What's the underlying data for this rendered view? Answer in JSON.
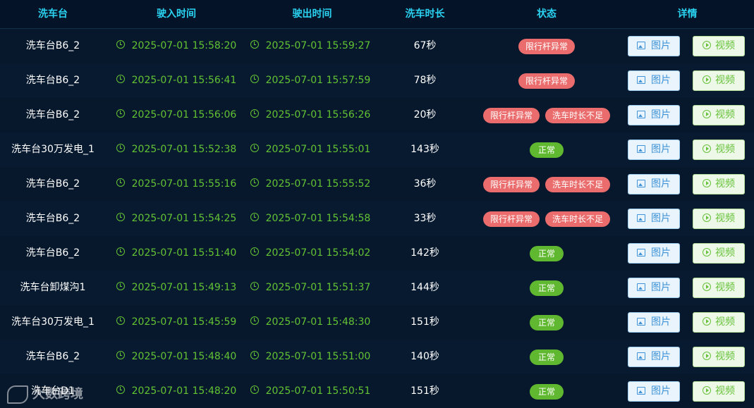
{
  "header": {
    "station": "洗车台",
    "entry_time": "驶入时间",
    "exit_time": "驶出时间",
    "duration": "洗车时长",
    "status": "状态",
    "detail": "详情"
  },
  "buttons": {
    "image_label": "图片",
    "video_label": "视频"
  },
  "colors": {
    "header_text": "#2ad3f2",
    "time_text": "#62c333",
    "error_badge": "#ea6c6c",
    "ok_badge": "#5fb82f"
  },
  "rows": [
    {
      "station": "洗车台B6_2",
      "entry": "2025-07-01 15:58:20",
      "exit": "2025-07-01 15:59:27",
      "duration": "67秒",
      "statuses": [
        {
          "label": "限行杆异常",
          "type": "error"
        }
      ]
    },
    {
      "station": "洗车台B6_2",
      "entry": "2025-07-01 15:56:41",
      "exit": "2025-07-01 15:57:59",
      "duration": "78秒",
      "statuses": [
        {
          "label": "限行杆异常",
          "type": "error"
        }
      ]
    },
    {
      "station": "洗车台B6_2",
      "entry": "2025-07-01 15:56:06",
      "exit": "2025-07-01 15:56:26",
      "duration": "20秒",
      "statuses": [
        {
          "label": "限行杆异常",
          "type": "error"
        },
        {
          "label": "洗车时长不足",
          "type": "error"
        }
      ]
    },
    {
      "station": "洗车台30万发电_1",
      "entry": "2025-07-01 15:52:38",
      "exit": "2025-07-01 15:55:01",
      "duration": "143秒",
      "statuses": [
        {
          "label": "正常",
          "type": "ok"
        }
      ]
    },
    {
      "station": "洗车台B6_2",
      "entry": "2025-07-01 15:55:16",
      "exit": "2025-07-01 15:55:52",
      "duration": "36秒",
      "statuses": [
        {
          "label": "限行杆异常",
          "type": "error"
        },
        {
          "label": "洗车时长不足",
          "type": "error"
        }
      ]
    },
    {
      "station": "洗车台B6_2",
      "entry": "2025-07-01 15:54:25",
      "exit": "2025-07-01 15:54:58",
      "duration": "33秒",
      "statuses": [
        {
          "label": "限行杆异常",
          "type": "error"
        },
        {
          "label": "洗车时长不足",
          "type": "error"
        }
      ]
    },
    {
      "station": "洗车台B6_2",
      "entry": "2025-07-01 15:51:40",
      "exit": "2025-07-01 15:54:02",
      "duration": "142秒",
      "statuses": [
        {
          "label": "正常",
          "type": "ok"
        }
      ]
    },
    {
      "station": "洗车台卸煤沟1",
      "entry": "2025-07-01 15:49:13",
      "exit": "2025-07-01 15:51:37",
      "duration": "144秒",
      "statuses": [
        {
          "label": "正常",
          "type": "ok"
        }
      ]
    },
    {
      "station": "洗车台30万发电_1",
      "entry": "2025-07-01 15:45:59",
      "exit": "2025-07-01 15:48:30",
      "duration": "151秒",
      "statuses": [
        {
          "label": "正常",
          "type": "ok"
        }
      ]
    },
    {
      "station": "洗车台B6_2",
      "entry": "2025-07-01 15:48:40",
      "exit": "2025-07-01 15:51:00",
      "duration": "140秒",
      "statuses": [
        {
          "label": "正常",
          "type": "ok"
        }
      ]
    },
    {
      "station": "洗车台D1",
      "entry": "2025-07-01 15:48:20",
      "exit": "2025-07-01 15:50:51",
      "duration": "151秒",
      "statuses": [
        {
          "label": "正常",
          "type": "ok"
        }
      ]
    }
  ],
  "watermark": {
    "text": "大数跨境"
  }
}
